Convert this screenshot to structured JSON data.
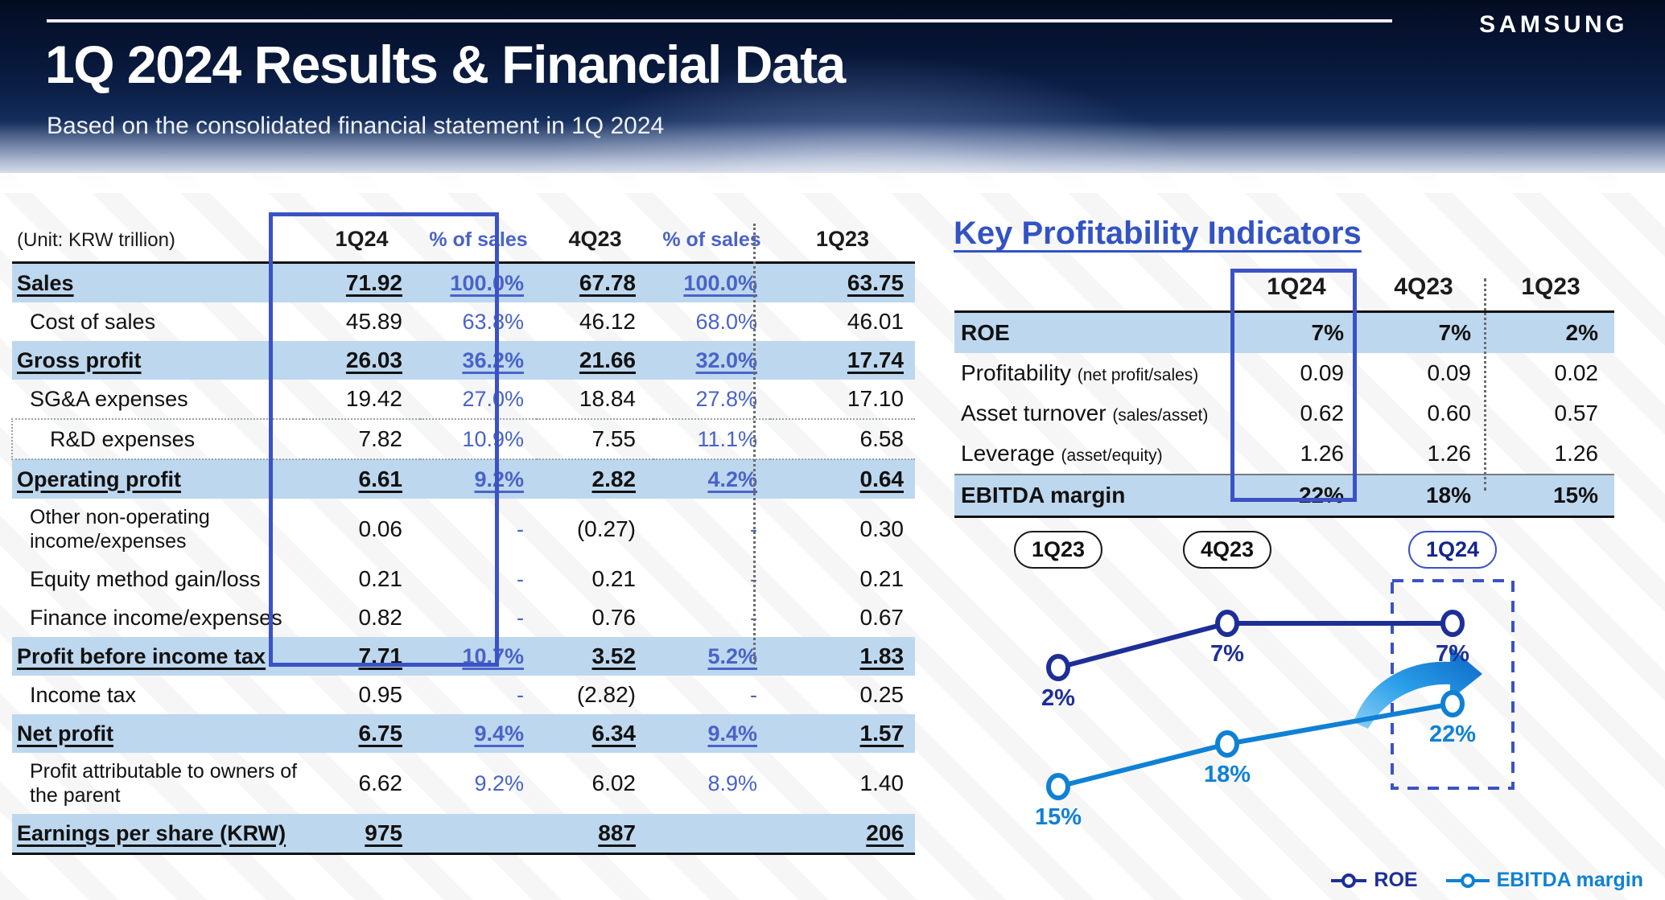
{
  "header": {
    "title": "1Q 2024 Results & Financial Data",
    "subtitle": "Based on the consolidated financial statement in 1Q 2024",
    "logo": "SAMSUNG"
  },
  "income_statement": {
    "unit_label": "(Unit: KRW trillion)",
    "columns": [
      "1Q24",
      "% of sales",
      "4Q23",
      "% of sales",
      "1Q23"
    ],
    "rows": [
      {
        "label": "Sales",
        "v1": "71.92",
        "p1": "100.0%",
        "v2": "67.78",
        "p2": "100.0%",
        "v3": "63.75",
        "highlight": true,
        "indent": 0
      },
      {
        "label": "Cost of sales",
        "v1": "45.89",
        "p1": "63.8%",
        "v2": "46.12",
        "p2": "68.0%",
        "v3": "46.01",
        "highlight": false,
        "indent": 1
      },
      {
        "label": "Gross profit",
        "v1": "26.03",
        "p1": "36.2%",
        "v2": "21.66",
        "p2": "32.0%",
        "v3": "17.74",
        "highlight": true,
        "indent": 0
      },
      {
        "label": "SG&A expenses",
        "v1": "19.42",
        "p1": "27.0%",
        "v2": "18.84",
        "p2": "27.8%",
        "v3": "17.10",
        "highlight": false,
        "indent": 1
      },
      {
        "label": "R&D expenses",
        "v1": "7.82",
        "p1": "10.9%",
        "v2": "7.55",
        "p2": "11.1%",
        "v3": "6.58",
        "highlight": false,
        "indent": 2
      },
      {
        "label": "Operating profit",
        "v1": "6.61",
        "p1": "9.2%",
        "v2": "2.82",
        "p2": "4.2%",
        "v3": "0.64",
        "highlight": true,
        "indent": 0
      },
      {
        "label": "Other non-operating income/expenses",
        "v1": "0.06",
        "p1": "-",
        "v2": "(0.27)",
        "p2": "-",
        "v3": "0.30",
        "highlight": false,
        "indent": 1
      },
      {
        "label": "Equity method gain/loss",
        "v1": "0.21",
        "p1": "-",
        "v2": "0.21",
        "p2": "-",
        "v3": "0.21",
        "highlight": false,
        "indent": 1
      },
      {
        "label": "Finance income/expenses",
        "v1": "0.82",
        "p1": "-",
        "v2": "0.76",
        "p2": "-",
        "v3": "0.67",
        "highlight": false,
        "indent": 1
      },
      {
        "label": "Profit before income tax",
        "v1": "7.71",
        "p1": "10.7%",
        "v2": "3.52",
        "p2": "5.2%",
        "v3": "1.83",
        "highlight": true,
        "indent": 0
      },
      {
        "label": "Income tax",
        "v1": "0.95",
        "p1": "-",
        "v2": "(2.82)",
        "p2": "-",
        "v3": "0.25",
        "highlight": false,
        "indent": 1
      },
      {
        "label": "Net profit",
        "v1": "6.75",
        "p1": "9.4%",
        "v2": "6.34",
        "p2": "9.4%",
        "v3": "1.57",
        "highlight": true,
        "indent": 0
      },
      {
        "label": "Profit attributable to owners of the parent",
        "v1": "6.62",
        "p1": "9.2%",
        "v2": "6.02",
        "p2": "8.9%",
        "v3": "1.40",
        "highlight": false,
        "indent": 1
      },
      {
        "label": "Earnings per share (KRW)",
        "v1": "975",
        "p1": "",
        "v2": "887",
        "p2": "",
        "v3": "206",
        "highlight": true,
        "indent": 0
      }
    ]
  },
  "kpi": {
    "title": "Key Profitability Indicators",
    "columns": [
      "1Q24",
      "4Q23",
      "1Q23"
    ],
    "rows": [
      {
        "label": "ROE",
        "paren": "",
        "values": [
          "7%",
          "7%",
          "2%"
        ],
        "highlight": true
      },
      {
        "label": "Profitability",
        "paren": "(net profit/sales)",
        "values": [
          "0.09",
          "0.09",
          "0.02"
        ],
        "highlight": false
      },
      {
        "label": "Asset turnover",
        "paren": "(sales/asset)",
        "values": [
          "0.62",
          "0.60",
          "0.57"
        ],
        "highlight": false
      },
      {
        "label": "Leverage",
        "paren": "(asset/equity)",
        "values": [
          "1.26",
          "1.26",
          "1.26"
        ],
        "highlight": false
      },
      {
        "label": "EBITDA margin",
        "paren": "",
        "values": [
          "22%",
          "18%",
          "15%"
        ],
        "highlight": true
      }
    ]
  },
  "chart_data": {
    "type": "line",
    "title": "",
    "categories": [
      "1Q23",
      "4Q23",
      "1Q24"
    ],
    "series": [
      {
        "name": "ROE",
        "values": [
          2,
          7,
          7
        ],
        "labels": [
          "2%",
          "7%",
          "7%"
        ],
        "color": "#1d2f96"
      },
      {
        "name": "EBITDA margin",
        "values": [
          15,
          18,
          22
        ],
        "labels": [
          "15%",
          "18%",
          "22%"
        ],
        "color": "#0f81d4"
      }
    ],
    "legend_position": "bottom-right",
    "grid": false,
    "highlight_period": "1Q24",
    "annotation": "up-right-arrow"
  },
  "colors": {
    "accent_blue": "#3b52c4",
    "band_blue": "#bdd7ee",
    "roe_navy": "#1d2f96",
    "ebitda_blue": "#0f81d4",
    "kpi_title": "#3353c4"
  }
}
